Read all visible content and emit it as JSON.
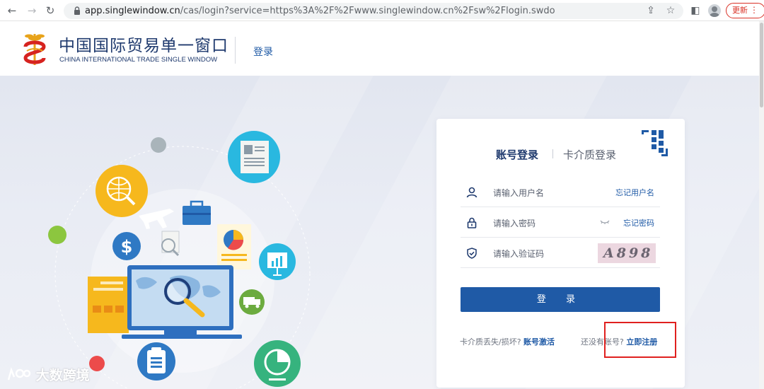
{
  "browser": {
    "url_host": "app.singlewindow.cn",
    "url_rest": "/cas/login?service=https%3A%2F%2Fwww.singlewindow.cn%2Fsw%2Flogin.swdo",
    "update_label": "更新",
    "icons": [
      "back-icon",
      "forward-icon",
      "reload-icon",
      "lock-icon",
      "share-icon",
      "star-icon",
      "side-panel-icon",
      "profile-icon",
      "more-icon"
    ]
  },
  "header": {
    "logo_cn": "中国国际贸易单一窗口",
    "logo_en": "CHINA INTERNATIONAL TRADE SINGLE WINDOW",
    "login_link": "登录"
  },
  "login": {
    "tab_account": "账号登录",
    "tab_card": "卡介质登录",
    "username_placeholder": "请输入用户名",
    "forgot_username": "忘记用户名",
    "password_placeholder": "请输入密码",
    "forgot_password": "忘记密码",
    "captcha_placeholder": "请输入验证码",
    "captcha_text": "A898",
    "submit_label": "登 录",
    "card_lost_text": "卡介质丢失/损坏?",
    "activate_link": "账号激活",
    "no_account_text": "还没有账号?",
    "register_link": "立即注册"
  },
  "watermark": {
    "text": "大数跨境"
  },
  "colors": {
    "brand_blue": "#1f5aa6",
    "dark_blue": "#1f3a6e",
    "highlight_red": "#e0201f"
  }
}
